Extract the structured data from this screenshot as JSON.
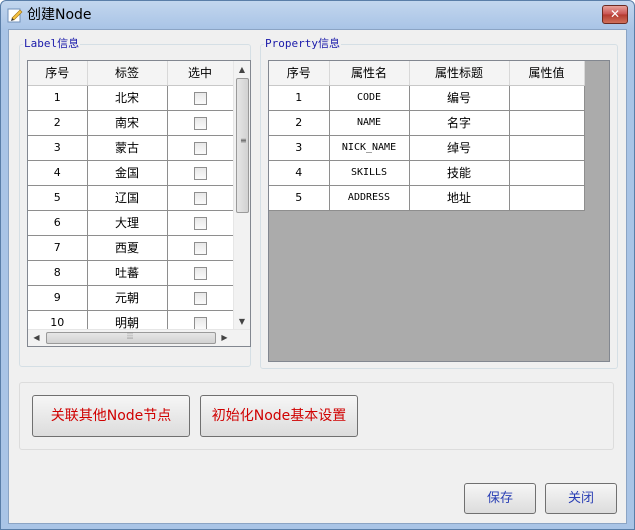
{
  "window": {
    "title": "创建Node",
    "close_label": "✕"
  },
  "label_group": {
    "title": "Label信息",
    "columns": [
      "序号",
      "标签",
      "选中"
    ],
    "rows": [
      {
        "no": "1",
        "label": "北宋"
      },
      {
        "no": "2",
        "label": "南宋"
      },
      {
        "no": "3",
        "label": "蒙古"
      },
      {
        "no": "4",
        "label": "金国"
      },
      {
        "no": "5",
        "label": "辽国"
      },
      {
        "no": "6",
        "label": "大理"
      },
      {
        "no": "7",
        "label": "西夏"
      },
      {
        "no": "8",
        "label": "吐蕃"
      },
      {
        "no": "9",
        "label": "元朝"
      },
      {
        "no": "10",
        "label": "明朝"
      }
    ]
  },
  "property_group": {
    "title": "Property信息",
    "columns": [
      "序号",
      "属性名",
      "属性标题",
      "属性值"
    ],
    "rows": [
      {
        "no": "1",
        "name": "CODE",
        "caption": "编号",
        "value": ""
      },
      {
        "no": "2",
        "name": "NAME",
        "caption": "名字",
        "value": ""
      },
      {
        "no": "3",
        "name": "NICK_NAME",
        "caption": "绰号",
        "value": ""
      },
      {
        "no": "4",
        "name": "SKILLS",
        "caption": "技能",
        "value": ""
      },
      {
        "no": "5",
        "name": "ADDRESS",
        "caption": "地址",
        "value": ""
      }
    ]
  },
  "actions": {
    "link_nodes": "关联其他Node节点",
    "init_settings": "初始化Node基本设置"
  },
  "footer": {
    "save": "保存",
    "close": "关闭"
  },
  "colors": {
    "action_text": "#d00000",
    "footer_text": "#2a3fb4",
    "group_title": "#1a1aaa"
  }
}
